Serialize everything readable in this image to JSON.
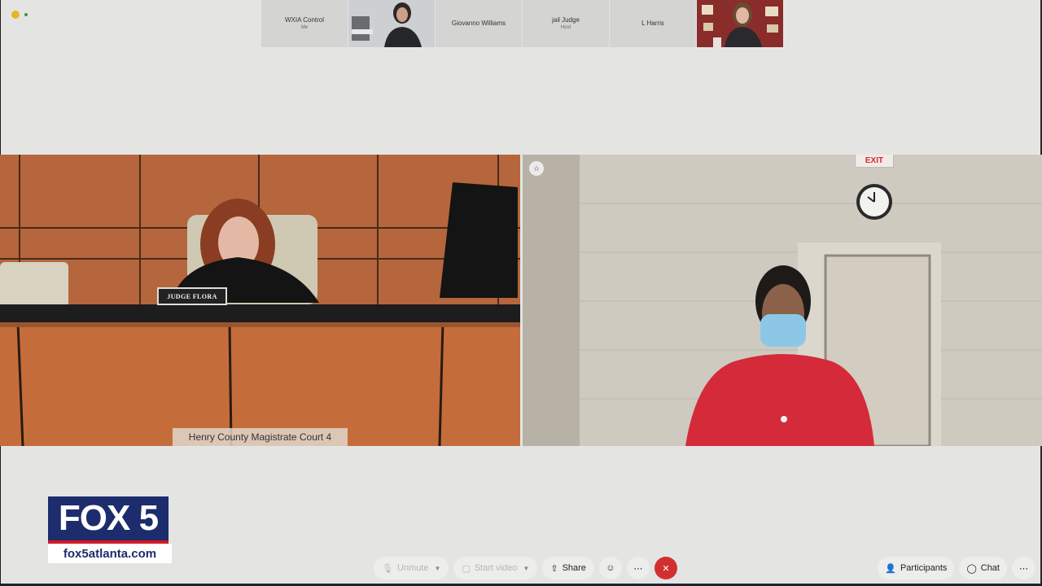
{
  "participants": [
    {
      "name": "WXIA Control",
      "sub": "Me",
      "video": false
    },
    {
      "name": "",
      "sub": "",
      "video": true
    },
    {
      "name": "Giovanno Williams",
      "sub": "",
      "video": false
    },
    {
      "name": "jail Judge",
      "sub": "Host",
      "video": false
    },
    {
      "name": "L Harris",
      "sub": "",
      "video": false
    },
    {
      "name": "",
      "sub": "",
      "video": true
    }
  ],
  "left_video": {
    "caption": "Henry County Magistrate Court 4",
    "nameplate": "JUDGE FLORA"
  },
  "right_video": {
    "exit_sign": "EXIT",
    "pin_icon": "pin-icon"
  },
  "logo": {
    "title": "FOX 5",
    "url": "fox5atlanta.com"
  },
  "toolbar": {
    "unmute_label": "Unmute",
    "start_video_label": "Start video",
    "share_label": "Share",
    "participants_label": "Participants",
    "chat_label": "Chat"
  },
  "colors": {
    "background": "#e4e5e3",
    "end_button": "#d32f2f",
    "logo_blue": "#1d2c6c",
    "logo_red": "#d21a26"
  }
}
